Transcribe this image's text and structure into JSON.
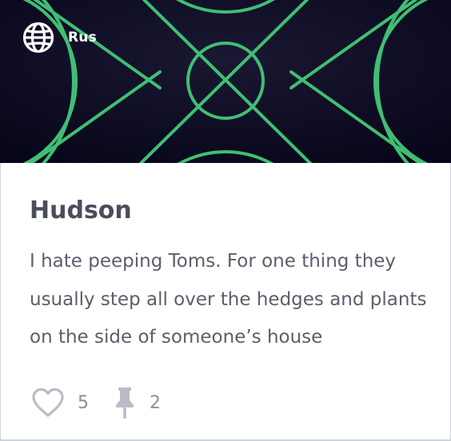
{
  "card": {
    "language": {
      "label": "Rus",
      "icon": "globe-icon"
    },
    "title": "Hudson",
    "body": "I hate peeping Toms. For one thing they usually step all over the hedges and plants on the side of someone’s house",
    "stats": {
      "likes": {
        "icon": "heart-icon",
        "count": "5"
      },
      "pins": {
        "icon": "pushpin-icon",
        "count": "2"
      }
    }
  },
  "colors": {
    "banner_background": "#0b0820",
    "banner_pattern": "#3fbf74",
    "title_text": "#4a4d5a",
    "body_text": "#5b5e6b",
    "stat_text": "#8b8f9c",
    "border": "#cfd2d8"
  }
}
